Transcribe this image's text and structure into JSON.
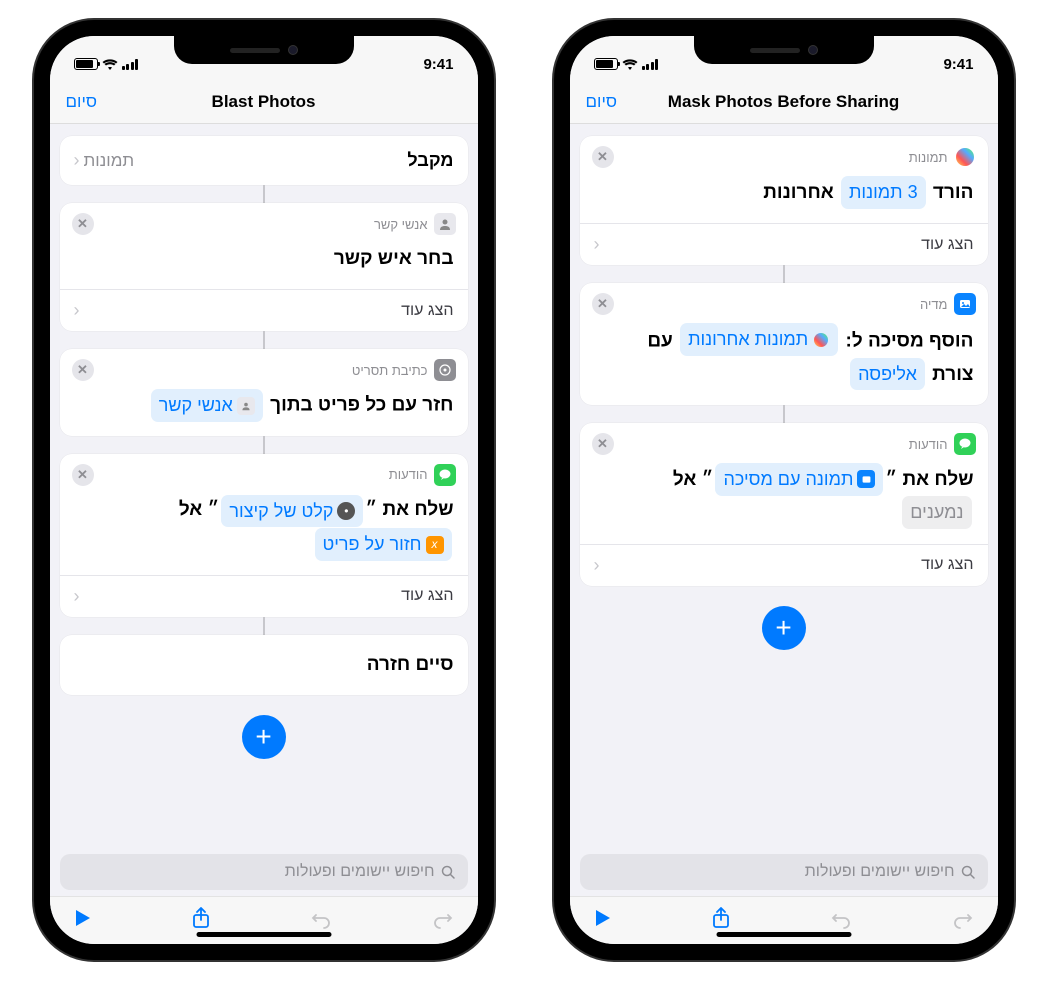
{
  "status": {
    "time": "9:41"
  },
  "left_phone": {
    "nav": {
      "done": "סיום",
      "title": "Blast Photos"
    },
    "accepts": {
      "label": "מקבל",
      "value": "תמונות"
    },
    "card_contacts": {
      "app": "אנשי קשר",
      "body": "בחר איש קשר",
      "show_more": "הצג עוד"
    },
    "card_script": {
      "app": "כתיבת תסריט",
      "body_prefix": "חזר עם כל פריט בתוך",
      "token": "אנשי קשר"
    },
    "card_messages": {
      "app": "הודעות",
      "prefix": "שלח את ״",
      "token1": "קלט של קיצור",
      "mid": "״ אל",
      "token2": "חזור על פריט",
      "show_more": "הצג עוד"
    },
    "card_end": {
      "body": "סיים חזרה"
    },
    "search": {
      "placeholder": "חיפוש יישומים ופעולות"
    }
  },
  "right_phone": {
    "nav": {
      "done": "סיום",
      "title": "Mask Photos Before Sharing"
    },
    "card_get": {
      "app": "תמונות",
      "body_prefix": "הורד",
      "token_count": "3 תמונות",
      "body_suffix": "אחרונות",
      "show_more": "הצג עוד"
    },
    "card_mask": {
      "app": "מדיה",
      "line1_prefix": "הוסף מסיכה ל:",
      "token_photos": "תמונות אחרונות",
      "line1_suffix": "עם",
      "line2_prefix": "צורת",
      "token_shape": "אליפסה"
    },
    "card_send": {
      "app": "הודעות",
      "prefix": "שלח את ״",
      "token1": "תמונה עם מסיכה",
      "mid": "״ אל",
      "token2": "נמענים",
      "show_more": "הצג עוד"
    },
    "search": {
      "placeholder": "חיפוש יישומים ופעולות"
    }
  }
}
